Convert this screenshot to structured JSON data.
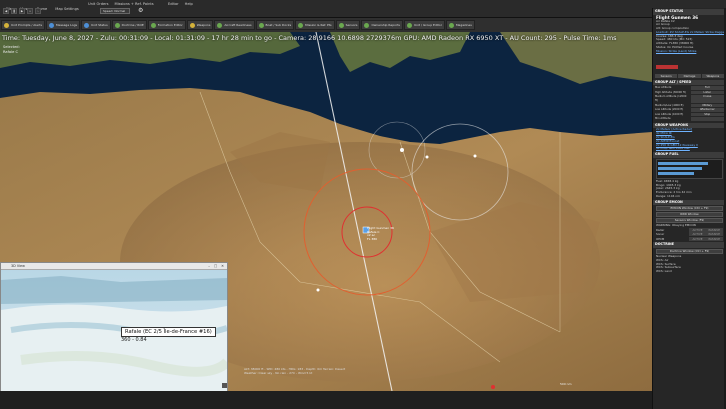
{
  "menubar": {
    "left_items": [
      "File",
      "View",
      "Game",
      "Map Settings"
    ],
    "mid_items": [
      "Unit Orders",
      "Missions + Ref. Points"
    ],
    "right_items": [
      "Editor",
      "Help"
    ],
    "speed_label": "Speed: Normal"
  },
  "toolbar": {
    "buttons": [
      {
        "label": "Unit Prompts / Alerts",
        "kind": "yel"
      },
      {
        "label": "Message Logs",
        "kind": "blue"
      },
      {
        "label": "Unit Status",
        "kind": "blue"
      },
      {
        "label": "Doctrine / ROE",
        "kind": "green"
      },
      {
        "label": "Formation Editor",
        "kind": "green"
      },
      {
        "label": "Weapons",
        "kind": "yel"
      },
      {
        "label": "Aircraft Readiness",
        "kind": "green"
      },
      {
        "label": "Boat / Sub Docks",
        "kind": "green"
      },
      {
        "label": "Mission & Ref. Pts",
        "kind": "green"
      },
      {
        "label": "Sensors",
        "kind": "green"
      },
      {
        "label": "Ownership Reports",
        "kind": "green"
      },
      {
        "label": "Unit / Group Editor",
        "kind": "green"
      },
      {
        "label": "Magazines",
        "kind": "green"
      }
    ]
  },
  "map": {
    "status_line": "Time: Tuesday, June 8, 2027 - Zulu: 00:31:09 - Local: 01:31:09 - 17 hr 28 min to go -  Camera: 28.9166 10.6898 2729376m  GPU: AMD Radeon RX 6950 XT - AU Count: 295 - Pulse Time: 1ms",
    "selected_label": "Selected:",
    "selected_unit": "Rafale C",
    "unit_label_lines": [
      "Flight Gunmen 36",
      "Rafale C",
      "x2 ac",
      "FL 380"
    ],
    "bottom_info_lines": [
      "ALT: 38000 ft - SPD: 480 kts - HDG: 183 - Depth: 0m  Terrain: Desert",
      "Weather: Clear sky - No rain - 27C - Wind 5 kt"
    ],
    "scale_label": "500 nm"
  },
  "mini_window": {
    "title": "3D View",
    "tooltip": "Rafale (EC 2/5 Île-de-France #16)",
    "coord": "360 - 0.84"
  },
  "panel": {
    "group_header": "GROUP STATUS",
    "group_name": "Flight Gunmen 36",
    "rows": [
      "Air Rafale C2",
      "Air Group",
      "Alt: Group composition",
      "Loadout: #2 SCALP-EG 2x Meteor Strike Dagger",
      "Course: 183.3 deg",
      "Speed: 480 kts (Mil: 523)",
      "Altitude: FL380 (38000 ft)",
      "Status: On Plotted Course",
      "Mission: Strike (Land) Strike"
    ],
    "tabs": [
      "Sensors",
      "Damage",
      "Weapons"
    ],
    "group_alt_speed_header": "GROUP ALT / SPEED",
    "alt_speed": [
      "Max Altitude",
      "Full",
      "High Altitude (36000 ft)",
      "Loiter",
      "Medium Altitude (12000 ft)",
      "Cruise",
      "Medium/Low (4000 ft)",
      "Military",
      "Low Altitude (2000 ft)",
      "Afterburner",
      "Low Altitude (1000 ft)",
      "Stop",
      "Min Altitude",
      ""
    ],
    "weapons_header": "GROUP WEAPONS",
    "weapons": [
      "2x Meteor [Active Radar]",
      "4x MICA IR",
      "2x SCALP-EG",
      "2x AM39 Exocet",
      "2x 250 lb GBU-12 Paveway II",
      "4x Drop Tank 2000 liter"
    ],
    "fuel_header": "GROUP FUEL",
    "fuel_rows": [
      "Fuel: 4658.4 kg",
      "Bingo: 1945.3 kg",
      "Joker: 2645.3 kg",
      "Endurance: 2 hrs 42 min",
      "Range: 1104 nm"
    ],
    "emcon_header": "GROUP EMCON",
    "emcon_buttons": [
      "EMCON Window (Ctrl + F9)",
      "RWR Window",
      "Sensors Window (F9)"
    ],
    "emcon_note": "WARNING: Obeying EMCON",
    "emcon_kv": [
      {
        "k": "Radar",
        "a": "ACTIVE",
        "b": "PASSIVE"
      },
      {
        "k": "Sonar",
        "a": "ACTIVE",
        "b": "PASSIVE"
      },
      {
        "k": "OECM",
        "a": "ACTIVE",
        "b": "PASSIVE"
      }
    ],
    "doctrine_header": "DOCTRINE",
    "doctrine_button": "Doctrine Window (Ctrl + F9)",
    "doctrine_rows": [
      "Nuclear Weapons",
      "WCS: Air",
      "WCS: Surface",
      "WCS: Subsurface",
      "WCS: Land"
    ]
  },
  "colors": {
    "panel_bg": "#262626",
    "link": "#6fb3ff",
    "unit_circle": "#e06030",
    "fuel_bar": "#5b9bd5"
  }
}
